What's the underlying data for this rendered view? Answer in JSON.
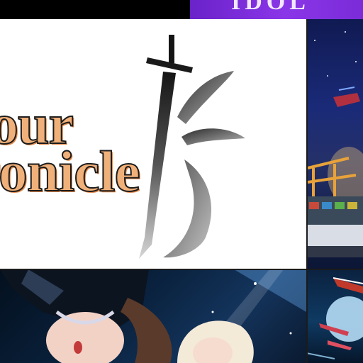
{
  "banner": {
    "title_line_1": "our",
    "title_line_2": "ronicle"
  },
  "top_banner": {
    "partial_text": "IDOL"
  },
  "colors": {
    "title_fill": "#f0b079",
    "title_outline": "#1c1c1c",
    "banner_background": "#ffffff",
    "top_banner_purple": "#8a36e8"
  },
  "icons": {
    "banner_logo": "sword-calligraphy-logo"
  }
}
